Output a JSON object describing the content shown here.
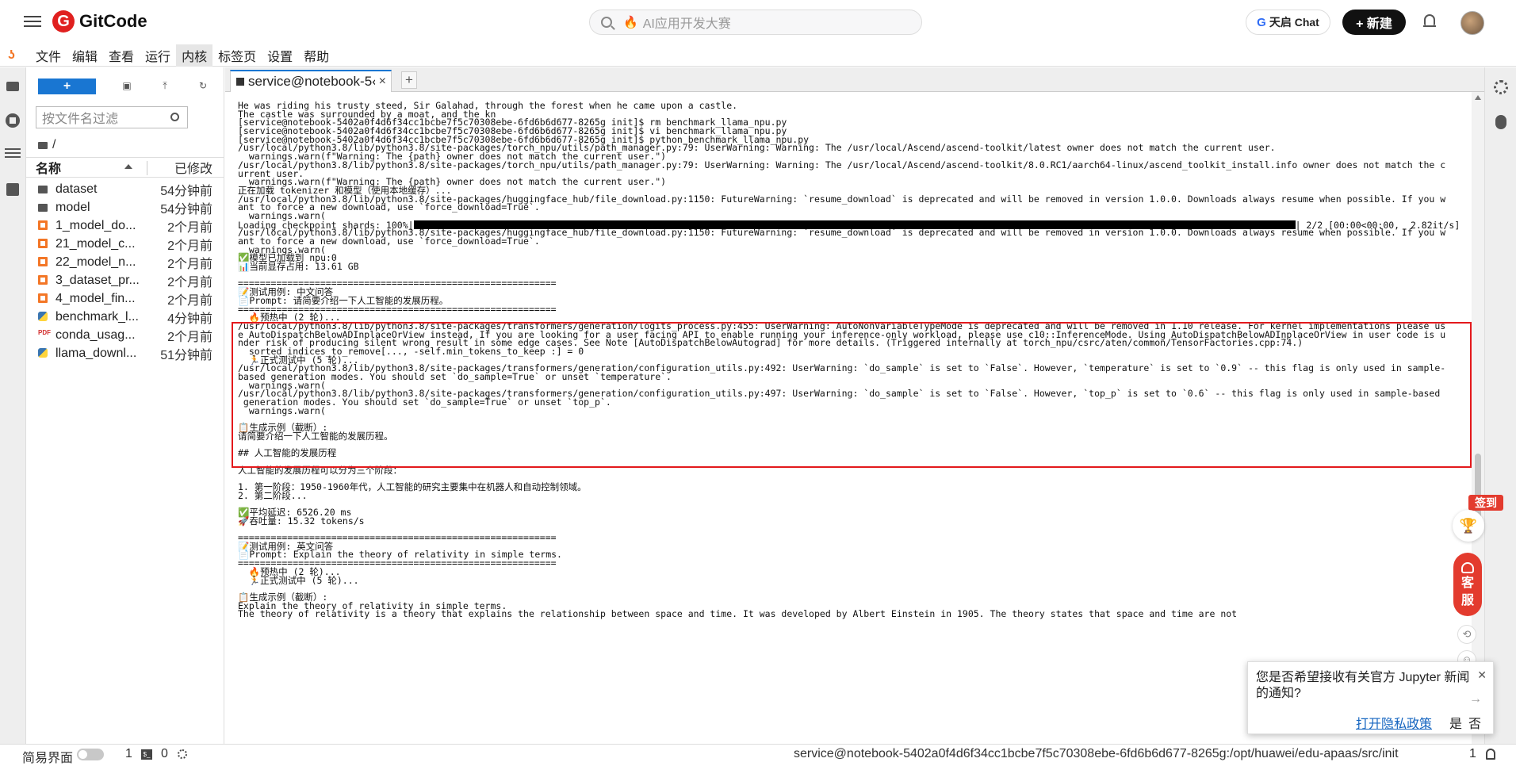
{
  "app": {
    "logo_mark": "G",
    "logo_text": "GitCode",
    "search_placeholder": "AI应用开发大赛",
    "tianqi_label": "天启 Chat",
    "tianqi_g": "G",
    "new_button": "+ 新建"
  },
  "menu": [
    "文件",
    "编辑",
    "查看",
    "运行",
    "内核",
    "标签页",
    "设置",
    "帮助"
  ],
  "menu_active_index": 4,
  "filebrowser": {
    "new_button": "+",
    "filter_placeholder": "按文件名过滤",
    "breadcrumb": "/",
    "col_name": "名称",
    "col_modified": "已修改",
    "files": [
      {
        "name": "dataset",
        "modified": "54分钟前",
        "type": "folder"
      },
      {
        "name": "model",
        "modified": "54分钟前",
        "type": "folder"
      },
      {
        "name": "1_model_do...",
        "modified": "2个月前",
        "type": "notebook"
      },
      {
        "name": "21_model_c...",
        "modified": "2个月前",
        "type": "notebook"
      },
      {
        "name": "22_model_n...",
        "modified": "2个月前",
        "type": "notebook"
      },
      {
        "name": "3_dataset_pr...",
        "modified": "2个月前",
        "type": "notebook"
      },
      {
        "name": "4_model_fin...",
        "modified": "2个月前",
        "type": "notebook"
      },
      {
        "name": "benchmark_l...",
        "modified": "4分钟前",
        "type": "python"
      },
      {
        "name": "conda_usag...",
        "modified": "2个月前",
        "type": "pdf"
      },
      {
        "name": "llama_downl...",
        "modified": "51分钟前",
        "type": "python"
      }
    ]
  },
  "tab": {
    "label": "service@notebook-5‹",
    "close": "×",
    "add": "+"
  },
  "terminal": {
    "progress_prefix": "Loading checkpoint shards: 100%|",
    "progress_suffix": "| 2/2 [00:00<00:00,  2.82it/s]",
    "progress_value": 1.0,
    "lines_before": [
      "He was riding his trusty steed, Sir Galahad, through the forest when he came upon a castle.",
      "The castle was surrounded by a moat, and the kn",
      "[service@notebook-5402a0f4d6f34cc1bcbe7f5c70308ebe-6fd6b6d677-8265g init]$ rm benchmark_llama_npu.py",
      "[service@notebook-5402a0f4d6f34cc1bcbe7f5c70308ebe-6fd6b6d677-8265g init]$ vi benchmark_llama_npu.py",
      "[service@notebook-5402a0f4d6f34cc1bcbe7f5c70308ebe-6fd6b6d677-8265g init]$ python benchmark_llama_npu.py",
      "/usr/local/python3.8/lib/python3.8/site-packages/torch_npu/utils/path_manager.py:79: UserWarning: Warning: The /usr/local/Ascend/ascend-toolkit/latest owner does not match the current user.",
      "  warnings.warn(f\"Warning: The {path} owner does not match the current user.\")",
      "/usr/local/python3.8/lib/python3.8/site-packages/torch_npu/utils/path_manager.py:79: UserWarning: Warning: The /usr/local/Ascend/ascend-toolkit/8.0.RC1/aarch64-linux/ascend_toolkit_install.info owner does not match the c",
      "urrent user.",
      "  warnings.warn(f\"Warning: The {path} owner does not match the current user.\")",
      "正在加载 tokenizer 和模型（使用本地缓存）...",
      "/usr/local/python3.8/lib/python3.8/site-packages/huggingface_hub/file_download.py:1150: FutureWarning: `resume_download` is deprecated and will be removed in version 1.0.0. Downloads always resume when possible. If you w",
      "ant to force a new download, use `force_download=True`.",
      "  warnings.warn("
    ],
    "lines_after_progress": [
      "/usr/local/python3.8/lib/python3.8/site-packages/huggingface_hub/file_download.py:1150: FutureWarning: `resume_download` is deprecated and will be removed in version 1.0.0. Downloads always resume when possible. If you w",
      "ant to force a new download, use `force_download=True`.",
      "  warnings.warn(",
      "✅模型已加载到 npu:0",
      "📊当前显存占用: 13.61 GB",
      "",
      "==========================================================",
      "📝测试用例: 中文问答",
      "📄Prompt: 请简要介绍一下人工智能的发展历程。",
      "==========================================================",
      "  🔥预热中 (2 轮)...",
      "/usr/local/python3.8/lib/python3.8/site-packages/transformers/generation/logits_process.py:455: UserWarning: AutoNonVariableTypeMode is deprecated and will be removed in 1.10 release. For kernel implementations please us",
      "e AutoDispatchBelowADInplaceOrView instead, If you are looking for a user facing API to enable running your inference-only workload, please use c10::InferenceMode. Using AutoDispatchBelowADInplaceOrView in user code is u",
      "nder risk of producing silent wrong result in some edge cases. See Note [AutoDispatchBelowAutograd] for more details. (Triggered internally at torch_npu/csrc/aten/common/TensorFactories.cpp:74.)",
      "  sorted_indices_to_remove[..., -self.min_tokens_to_keep :] = 0",
      "  🏃正式测试中 (5 轮)...",
      "/usr/local/python3.8/lib/python3.8/site-packages/transformers/generation/configuration_utils.py:492: UserWarning: `do_sample` is set to `False`. However, `temperature` is set to `0.9` -- this flag is only used in sample-",
      "based generation modes. You should set `do_sample=True` or unset `temperature`.",
      "  warnings.warn(",
      "/usr/local/python3.8/lib/python3.8/site-packages/transformers/generation/configuration_utils.py:497: UserWarning: `do_sample` is set to `False`. However, `top_p` is set to `0.6` -- this flag is only used in sample-based",
      " generation modes. You should set `do_sample=True` or unset `top_p`.",
      "  warnings.warn(",
      "",
      "📋生成示例（截断）:",
      "请简要介绍一下人工智能的发展历程。",
      "",
      "## 人工智能的发展历程",
      "",
      "人工智能的发展历程可以分为三个阶段：",
      "",
      "1. 第一阶段：1950-1960年代，人工智能的研究主要集中在机器人和自动控制领域。",
      "2. 第二阶段...",
      "",
      "✅平均延迟: 6526.20 ms",
      "🚀吞吐量: 15.32 tokens/s",
      "",
      "==========================================================",
      "📝测试用例: 英文问答",
      "📄Prompt: Explain the theory of relativity in simple terms.",
      "==========================================================",
      "  🔥预热中 (2 轮)...",
      "  🏃正式测试中 (5 轮)...",
      "",
      "📋生成示例（截断）:",
      "Explain the theory of relativity in simple terms.",
      "The theory of relativity is a theory that explains the relationship between space and time. It was developed by Albert Einstein in 1905. The theory states that space and time are not"
    ]
  },
  "floats": {
    "qiandao": "签到",
    "kefu1": "客",
    "kefu2": "服"
  },
  "notification": {
    "message": "您是否希望接收有关官方 Jupyter 新闻的通知?",
    "privacy_link": "打开隐私政策",
    "yes": "是",
    "no": "否"
  },
  "statusbar": {
    "simple_mode": "简易界面",
    "kernels": "1",
    "terminals": "0",
    "path": "service@notebook-5402a0f4d6f34cc1bcbe7f5c70308ebe-6fd6b6d677-8265g:/opt/huawei/edu-apaas/src/init",
    "right_count": "1"
  }
}
